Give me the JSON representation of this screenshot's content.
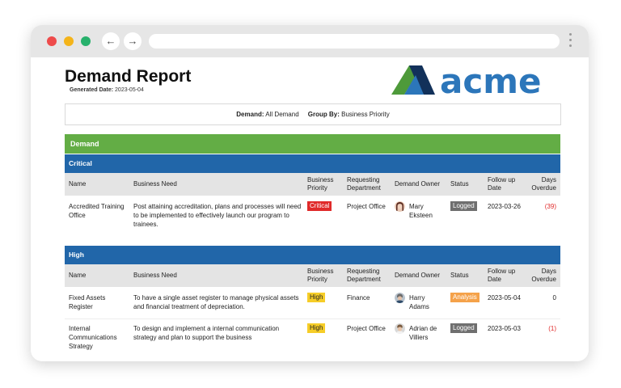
{
  "report": {
    "title": "Demand Report",
    "generated_label": "Generated Date:",
    "generated_date": "2023-05-04",
    "logo_text": "acme"
  },
  "filters": {
    "demand_label": "Demand:",
    "demand_value": "All Demand",
    "group_label": "Group By:",
    "group_value": "Business Priority"
  },
  "section_title": "Demand",
  "columns": {
    "name": "Name",
    "need": "Business Need",
    "priority_1": "Business",
    "priority_2": "Priority",
    "dept_1": "Requesting",
    "dept_2": "Department",
    "owner": "Demand Owner",
    "status": "Status",
    "follow_1": "Follow up",
    "follow_2": "Date",
    "days_1": "Days",
    "days_2": "Overdue"
  },
  "groups": [
    {
      "label": "Critical",
      "rows": [
        {
          "name_1": "Accredited Training",
          "name_2": "Office",
          "need_1": "Post attaining accreditation, plans and processes will need",
          "need_2": "to be implemented to effectively launch our program to",
          "need_3": "trainees.",
          "priority": "Critical",
          "dept": "Project Office",
          "owner_1": "Mary",
          "owner_2": "Eksteen",
          "status": "Logged",
          "follow": "2023-03-26",
          "days": "(39)"
        }
      ]
    },
    {
      "label": "High",
      "rows": [
        {
          "name_1": "Fixed Assets",
          "name_2": "Register",
          "need_1": "To have a single asset register to manage physical assets",
          "need_2": "and financial treatment of depreciation.",
          "priority": "High",
          "dept": "Finance",
          "owner_1": "Harry",
          "owner_2": "Adams",
          "status": "Analysis",
          "follow": "2023-05-04",
          "days": "0"
        },
        {
          "name_1": "Internal",
          "name_2": "Communications",
          "name_3": "Strategy",
          "need_1": "To design and implement  a internal communication",
          "need_2": "strategy and plan to support the business",
          "priority": "High",
          "dept": "Project Office",
          "owner_1": "Adrian de",
          "owner_2": "Villiers",
          "status": "Logged",
          "follow": "2023-05-03",
          "days": "(1)"
        }
      ]
    }
  ],
  "colors": {
    "demand_bar": "#63ad45",
    "group_bar": "#2166a9",
    "critical": "#e02a2a",
    "high": "#f6cd28",
    "logged": "#6f6f6f",
    "analysis": "#f5a24a",
    "logo_blue": "#2c76ba",
    "logo_green": "#4e9a3a",
    "logo_dark": "#12315a"
  }
}
